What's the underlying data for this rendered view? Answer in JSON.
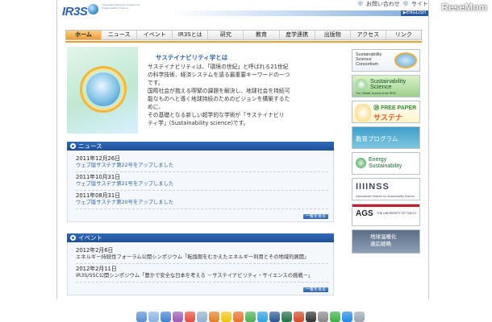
{
  "header": {
    "logo": "IR3S",
    "logo_subtitle": "Integrated Research System for Sustainability Science",
    "top_links": [
      "お問い合わせ",
      "サイト"
    ],
    "english": "▶ENGLISH"
  },
  "nav": {
    "items": [
      "ホーム",
      "ニュース",
      "イベント",
      "IR3Sとは",
      "研究",
      "教育",
      "産学連携",
      "出版物",
      "アクセス",
      "リンク"
    ]
  },
  "hero": {
    "title": "サステイナビリティ学とは",
    "text": "サステイナビリティは、「環境の世紀」と呼ばれる21世紀\nの科学技術、経済システムを語る最重要キーワードの一つ\nです。\n国際社会が抱える喫緊の課題を解決し、地球社会を持続可\n能なものへと導く地球持続のためのビジョンを構築するた\nめに、\nその基礎となる新しい超学的な学術が「サステイナビリ\nティ学」(Sustainability science)です。"
  },
  "news": {
    "heading": "ニュース",
    "items": [
      {
        "date": "2011年12月26日",
        "text": "ウェブ版サステナ第22号をアップしました"
      },
      {
        "date": "2011年10月31日",
        "text": "ウェブ版サステナ第21号をアップしました"
      },
      {
        "date": "2011年08月31日",
        "text": "ウェブ版サステナ第20号をアップしました"
      }
    ],
    "more": "一覧を見る"
  },
  "events": {
    "heading": "イベント",
    "items": [
      {
        "date": "2012年2月6日",
        "text": "エネルギー持続性フォーラム公開シンポジウム「転換期をむかえたエネルギー利用とその地域的展開」"
      },
      {
        "date": "2012年2月11日",
        "text": "IR3S/SSC公開シンポジウム「豊かで安全な日本を考える －サステイナビリティ・サイエンスの挑戦－」"
      }
    ],
    "more": "一覧を見る"
  },
  "sidebar": {
    "b1": "Sustainability\nScience\nConsortium",
    "b2_title": "Sustainability\nScience",
    "b2_sub": "The Official Journal of the IR3S",
    "b3_top": "⑳ FREE PAPER",
    "b3_main": "サステナ",
    "b4": "教育プログラム",
    "b5": "Energy\nSustainability",
    "b6": "IIIINSS",
    "b6_sub": "International Network for Sustainability Science",
    "b7": "AGS",
    "b7_sub": "THE UNIVERSITY OF TOKYO",
    "b8": "地球温暖化\n適応戦略"
  },
  "watermark": "ReseMom",
  "dock": {
    "icons": [
      "finder",
      "mail",
      "safari",
      "itunes",
      "calendar",
      "preview",
      "photos",
      "notes",
      "firefox",
      "chrome",
      "skype",
      "word",
      "excel",
      "powerpoint",
      "terminal",
      "settings",
      "evernote",
      "dropbox",
      "trash"
    ],
    "colors": [
      "#5a8fd0",
      "#88b4e6",
      "#3d83d1",
      "#9b59b6",
      "#e74c3c",
      "#8fb2d0",
      "#e67e22",
      "#f1c40f",
      "#e8702a",
      "#4caf50",
      "#2aa3e0",
      "#2b5797",
      "#1e7145",
      "#d24726",
      "#333333",
      "#888888",
      "#3cb043",
      "#1e88e5",
      "#9aa5b1"
    ]
  }
}
